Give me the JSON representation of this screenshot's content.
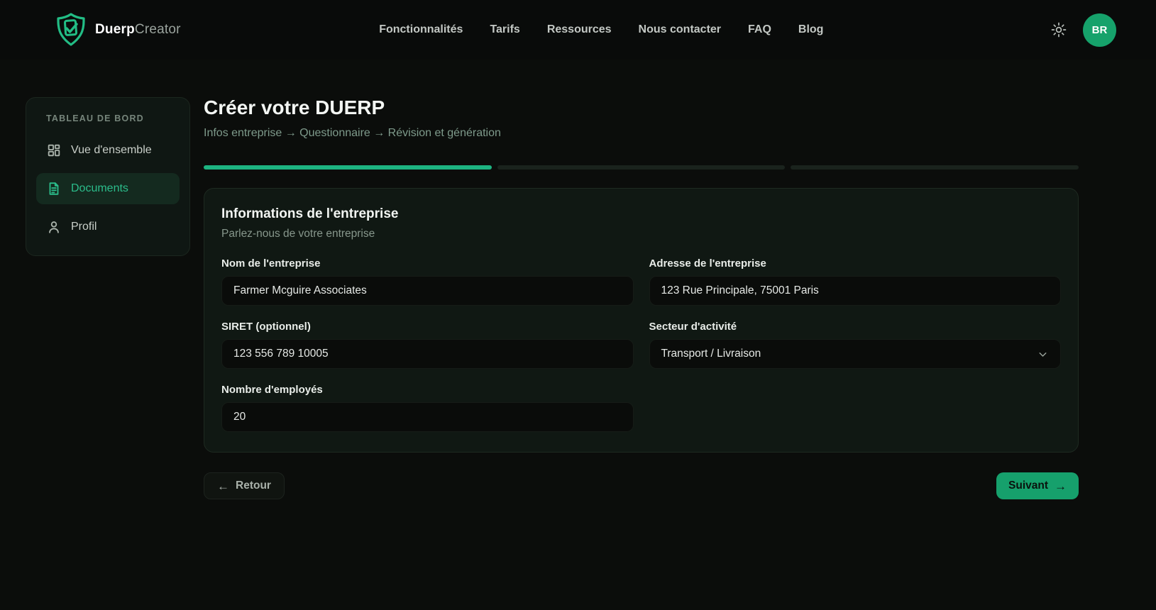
{
  "header": {
    "brand": {
      "name_bold": "Duerp",
      "name_light": "Creator"
    },
    "nav": {
      "features": "Fonctionnalités",
      "pricing": "Tarifs",
      "resources": "Ressources",
      "contact": "Nous contacter",
      "faq": "FAQ",
      "blog": "Blog"
    },
    "avatar_initials": "BR"
  },
  "sidebar": {
    "section_title": "TABLEAU DE BORD",
    "items": {
      "overview": {
        "label": "Vue d'ensemble"
      },
      "documents": {
        "label": "Documents"
      },
      "profile": {
        "label": "Profil"
      }
    }
  },
  "main": {
    "title": "Créer votre DUERP",
    "breadcrumb": "Infos entreprise → Questionnaire → Révision et génération",
    "progress": {
      "total_steps": 3,
      "current_step": 1
    },
    "card": {
      "title": "Informations de l'entreprise",
      "subtitle": "Parlez-nous de votre entreprise",
      "fields": {
        "company_name": {
          "label": "Nom de l'entreprise",
          "value": "Farmer Mcguire Associates"
        },
        "address": {
          "label": "Adresse de l'entreprise",
          "value": "123 Rue Principale, 75001 Paris"
        },
        "siret": {
          "label": "SIRET (optionnel)",
          "value": "123 556 789 10005"
        },
        "sector": {
          "label": "Secteur d'activité",
          "value": "Transport / Livraison"
        },
        "employees": {
          "label": "Nombre d'employés",
          "value": "20"
        }
      }
    },
    "actions": {
      "back": "Retour",
      "next": "Suivant"
    }
  },
  "icons": {
    "arrow_left": "←",
    "arrow_right": "→"
  },
  "colors": {
    "accent_green": "#16a06c",
    "progress_green": "#1db381",
    "avatar_green": "#16a26b",
    "active_item_text": "#2bbd8b",
    "card_background": "#101813",
    "page_background": "#0b0d0b"
  }
}
